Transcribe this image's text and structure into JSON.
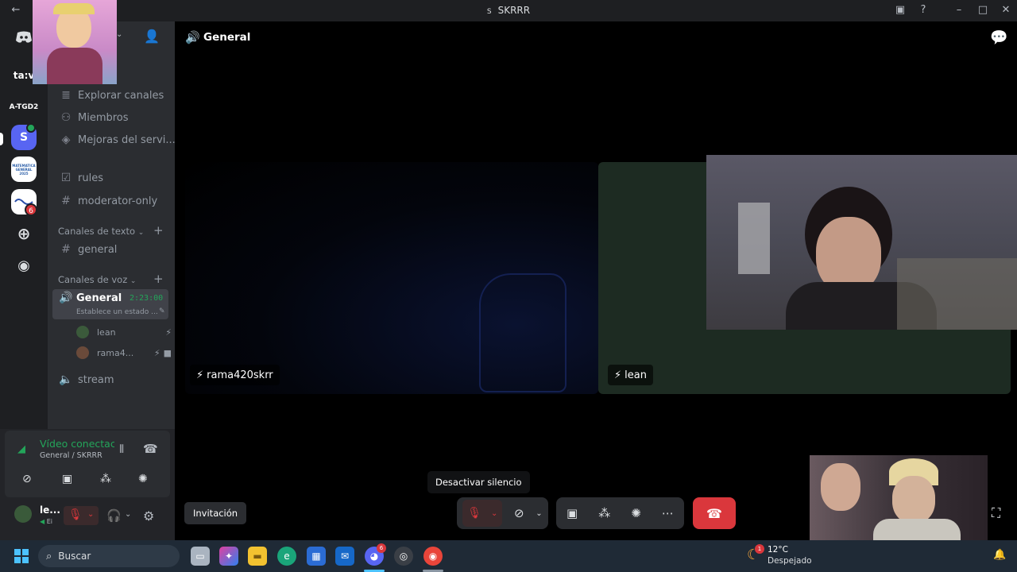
{
  "window": {
    "title": "SKRRR",
    "server_initial": "S"
  },
  "rail": {
    "items": [
      {
        "label": "ta:v"
      },
      {
        "label": "A-TGD2"
      },
      {
        "label": "S"
      },
      {
        "label": "MATEMATICA GENERAL 2025"
      },
      {
        "label": "6"
      }
    ]
  },
  "sidebar": {
    "explore": "Explorar canales",
    "members": "Miembros",
    "boosts": "Mejoras del servi...",
    "rules": "rules",
    "moderator": "moderator-only",
    "text_category": "Canales de texto",
    "general_text": "general",
    "voice_category": "Canales de voz",
    "voice_channel": {
      "name": "General",
      "timer": "2:23:00",
      "status": "Establece un estado ..."
    },
    "voice_users": [
      {
        "name": "lean"
      },
      {
        "name": "rama4..."
      }
    ],
    "stream": "stream"
  },
  "voice_panel": {
    "status": "Vídeo conectac",
    "location": "General / SKRRR"
  },
  "user": {
    "name": "le...",
    "status": "Ei"
  },
  "main": {
    "channel_name": "General",
    "tiles": [
      {
        "label": "rama420skrr"
      },
      {
        "label": "lean"
      }
    ],
    "invite_label": "Invitación",
    "tooltip": "Desactivar silencio"
  },
  "taskbar": {
    "search_placeholder": "Buscar",
    "discord_badge": "6",
    "weather_temp": "12°C",
    "weather_desc": "Despejado",
    "weather_badge": "1"
  },
  "colors": {
    "accent": "#5865f2",
    "danger": "#da373c",
    "online": "#23a55a"
  }
}
